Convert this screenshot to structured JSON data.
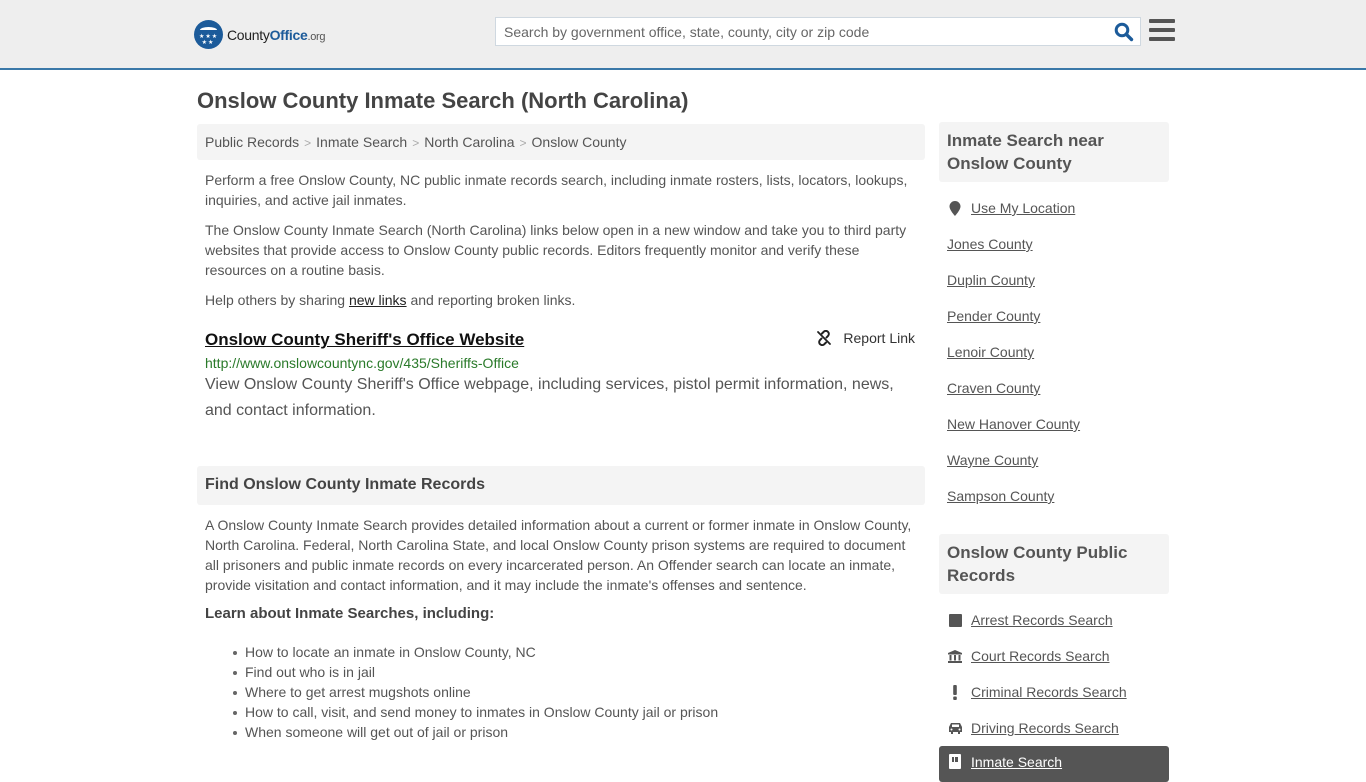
{
  "header": {
    "logo": {
      "name_part1": "County",
      "name_part2": "Office",
      "tld": ".org"
    },
    "search": {
      "placeholder": "Search by government office, state, county, city or zip code",
      "value": ""
    },
    "icons": {
      "search": "search-icon",
      "menu": "hamburger-menu-icon"
    }
  },
  "page": {
    "title": "Onslow County Inmate Search (North Carolina)",
    "breadcrumb": [
      "Public Records",
      "Inmate Search",
      "North Carolina",
      "Onslow County"
    ],
    "breadcrumb_separator": ">",
    "intro": {
      "p1": "Perform a free Onslow County, NC public inmate records search, including inmate rosters, lists, locators, lookups, inquiries, and active jail inmates.",
      "p2": "The Onslow County Inmate Search (North Carolina) links below open in a new window and take you to third party websites that provide access to Onslow County public records. Editors frequently monitor and verify these resources on a routine basis.",
      "p3_before": "Help others by sharing ",
      "p3_link": "new links",
      "p3_after": " and reporting broken links."
    },
    "results": [
      {
        "title": "Onslow County Sheriff's Office Website",
        "url": "http://www.onslowcountync.gov/435/Sheriffs-Office",
        "description": "View Onslow County Sheriff's Office webpage, including services, pistol permit information, news, and contact information.",
        "report_label": "Report Link"
      }
    ],
    "find_section": {
      "heading": "Find Onslow County Inmate Records",
      "body": "A Onslow County Inmate Search provides detailed information about a current or former inmate in Onslow County, North Carolina. Federal, North Carolina State, and local Onslow County prison systems are required to document all prisoners and public inmate records on every incarcerated person. An Offender search can locate an inmate, provide visitation and contact information, and it may include the inmate's offenses and sentence.",
      "learn_heading": "Learn about Inmate Searches, including:",
      "learn_items": [
        "How to locate an inmate in Onslow County, NC",
        "Find out who is in jail",
        "Where to get arrest mugshots online",
        "How to call, visit, and send money to inmates in Onslow County jail or prison",
        "When someone will get out of jail or prison"
      ]
    }
  },
  "sidebar": {
    "near": {
      "heading": "Inmate Search near Onslow County",
      "use_location": "Use My Location",
      "counties": [
        "Jones County",
        "Duplin County",
        "Pender County",
        "Lenoir County",
        "Craven County",
        "New Hanover County",
        "Wayne County",
        "Sampson County"
      ]
    },
    "records": {
      "heading": "Onslow County Public Records",
      "items": [
        {
          "label": "Arrest Records Search",
          "icon": "square-icon"
        },
        {
          "label": "Court Records Search",
          "icon": "courthouse-icon"
        },
        {
          "label": "Criminal Records Search",
          "icon": "exclamation-icon"
        },
        {
          "label": "Driving Records Search",
          "icon": "car-icon"
        },
        {
          "label": "Inmate Search",
          "icon": "jail-door-icon",
          "active": true
        }
      ]
    }
  },
  "colors": {
    "brand_blue": "#1c5b9a",
    "header_border": "#3a78a8",
    "url_green": "#2a7a2a",
    "active_bg": "#555555"
  }
}
